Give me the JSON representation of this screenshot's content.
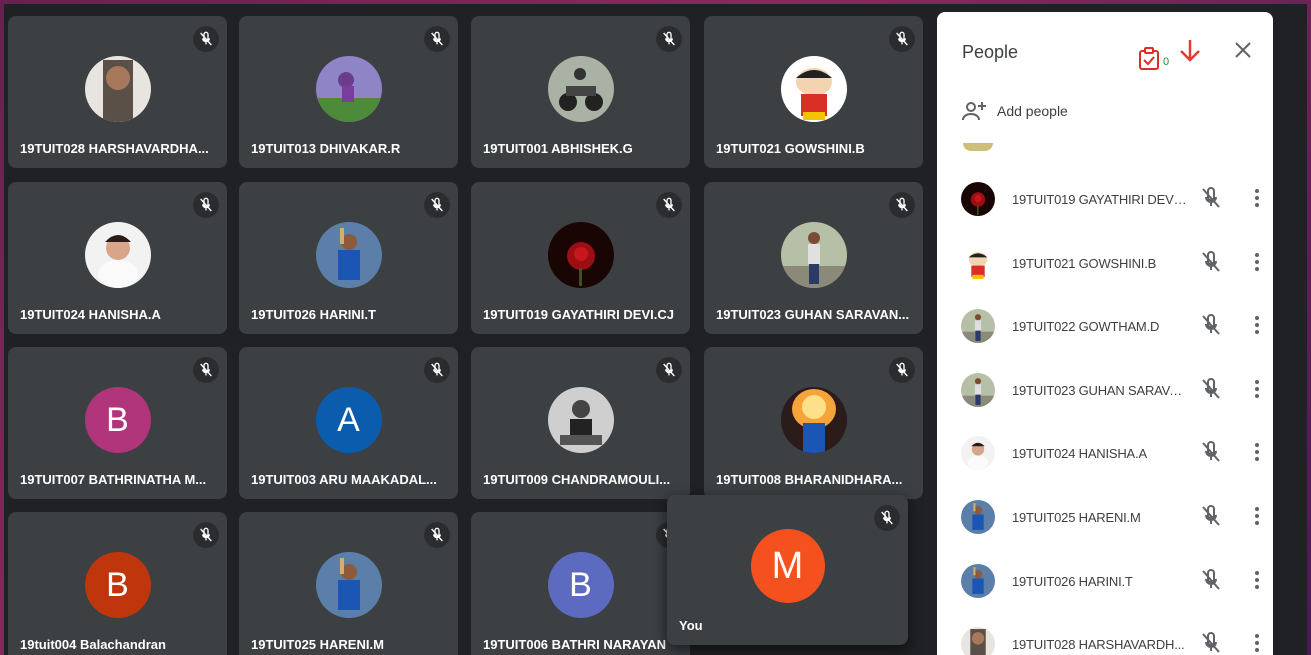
{
  "tiles": [
    {
      "name": "19TUIT028 HARSHAVARDHA...",
      "avatar": "photo-person",
      "bg": "#d8d2cc"
    },
    {
      "name": "19TUIT013 DHIVAKAR.R",
      "avatar": "photo-field",
      "bg": "#8a7ab0"
    },
    {
      "name": "19TUIT001 ABHISHEK.G",
      "avatar": "photo-bike",
      "bg": "#707a70"
    },
    {
      "name": "19TUIT021 GOWSHINI.B",
      "avatar": "photo-cartoon",
      "bg": "#ffffff"
    },
    {
      "name": "19TUIT024 HANISHA.A",
      "avatar": "photo-baby",
      "bg": "#efefef"
    },
    {
      "name": "19TUIT026 HARINI.T",
      "avatar": "photo-cricket",
      "bg": "#3a6ea8"
    },
    {
      "name": "19TUIT019 GAYATHIRI DEVI.CJ",
      "avatar": "photo-rose",
      "bg": "#2a0a0a"
    },
    {
      "name": "19TUIT023 GUHAN SARAVAN...",
      "avatar": "photo-standing",
      "bg": "#9aa88a"
    },
    {
      "name": "19TUIT007 BATHRINATHA M...",
      "avatar": "letter",
      "letter": "B",
      "bg": "#b0357a"
    },
    {
      "name": "19TUIT003 ARU MAAKADAL...",
      "avatar": "letter",
      "letter": "A",
      "bg": "#0b5cad"
    },
    {
      "name": "19TUIT009 CHANDRAMOULI...",
      "avatar": "photo-bw",
      "bg": "#7d7d7d"
    },
    {
      "name": "19TUIT008 BHARANIDHARA...",
      "avatar": "photo-fire",
      "bg": "#c86a30"
    },
    {
      "name": "19tuit004 Balachandran",
      "avatar": "letter",
      "letter": "B",
      "bg": "#c0360c"
    },
    {
      "name": "19TUIT025 HARENI.M",
      "avatar": "photo-cricket",
      "bg": "#2f5d95"
    },
    {
      "name": "19TUIT006 BATHRI NARAYAN",
      "avatar": "letter",
      "letter": "B",
      "bg": "#5c6bc0"
    }
  ],
  "self": {
    "label": "You",
    "letter": "M",
    "color": "#f4511e"
  },
  "panel": {
    "title": "People",
    "add_people": "Add people",
    "counter": "0",
    "participants": [
      {
        "name": "19TUIT019 GAYATHIRI DEVI...",
        "avatar": "photo-rose"
      },
      {
        "name": "19TUIT021 GOWSHINI.B",
        "avatar": "photo-cartoon"
      },
      {
        "name": "19TUIT022 GOWTHAM.D",
        "avatar": "photo-standing"
      },
      {
        "name": "19TUIT023 GUHAN SARAVA...",
        "avatar": "photo-standing"
      },
      {
        "name": "19TUIT024 HANISHA.A",
        "avatar": "photo-baby"
      },
      {
        "name": "19TUIT025 HARENI.M",
        "avatar": "photo-cricket"
      },
      {
        "name": "19TUIT026 HARINI.T",
        "avatar": "photo-cricket"
      },
      {
        "name": "19TUIT028 HARSHAVARDH...",
        "avatar": "photo-person"
      }
    ]
  },
  "icons": {
    "muted_mic": "mic-off-icon",
    "close": "close-icon",
    "add_person": "person-add-icon",
    "more": "more-vert-icon",
    "clipboard": "clipboard-check-icon",
    "arrow": "arrow-down-icon"
  }
}
